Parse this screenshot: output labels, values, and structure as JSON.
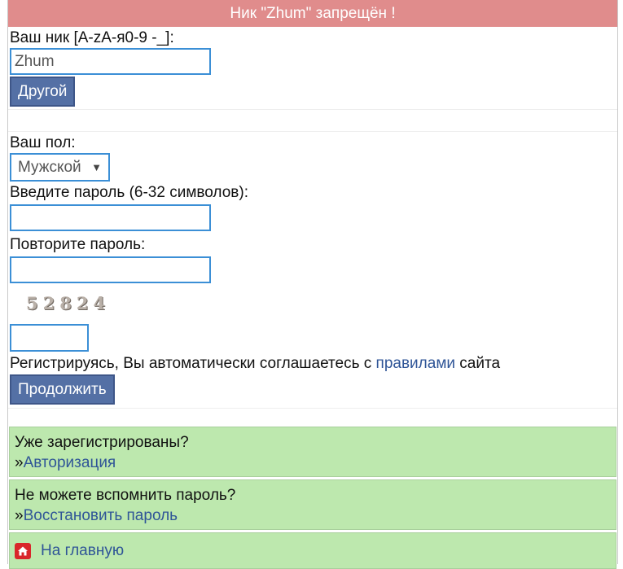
{
  "error": {
    "message": "Ник \"Zhum\" запрещён !"
  },
  "nick": {
    "label": "Ваш ник [A-zA-я0-9 -_]:",
    "value": "Zhum",
    "other_button": "Другой"
  },
  "gender": {
    "label": "Ваш пол:",
    "selected": "Мужской"
  },
  "password": {
    "label": "Введите пароль (6-32 символов):",
    "value": ""
  },
  "password_repeat": {
    "label": "Повторите пароль:",
    "value": ""
  },
  "captcha": {
    "code": "52824",
    "input_value": ""
  },
  "agreement": {
    "prefix": "Регистрируясь, Вы автоматически соглашаетесь с ",
    "link": "правилами",
    "suffix": " сайта"
  },
  "continue_button": "Продолжить",
  "login_box": {
    "question": "Уже зарегистрированы?",
    "arrow": "»",
    "link": "Авторизация"
  },
  "recover_box": {
    "question": "Не можете вспомнить пароль?",
    "arrow": "»",
    "link": "Восстановить пароль"
  },
  "home": {
    "link": "На главную",
    "icon": "home-icon"
  },
  "colors": {
    "error_banner": "#e08c8c",
    "button": "#5470a5",
    "input_border": "#3b8fd6",
    "green_box": "#bde8ae",
    "link": "#2f5597",
    "home_icon": "#d9262b"
  }
}
